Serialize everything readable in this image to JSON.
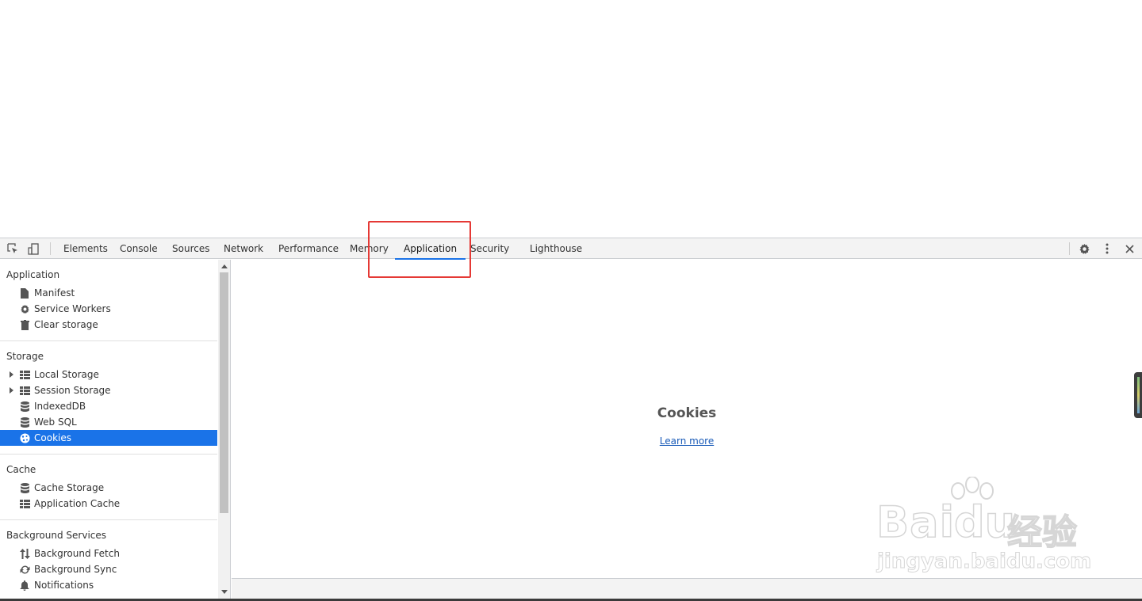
{
  "toolbar": {
    "inspect_icon": "inspect-element-icon",
    "device_icon": "device-toolbar-icon",
    "tabs": [
      {
        "label": "Elements"
      },
      {
        "label": "Console"
      },
      {
        "label": "Sources"
      },
      {
        "label": "Network"
      },
      {
        "label": "Performance"
      },
      {
        "label": "Memory"
      },
      {
        "label": "Application"
      },
      {
        "label": "Security"
      },
      {
        "label": "Lighthouse"
      }
    ],
    "active_tab": "Application",
    "settings_icon": "gear-icon",
    "menu_icon": "kebab-menu-icon",
    "close_icon": "close-icon"
  },
  "sidebar": {
    "application": {
      "title": "Application",
      "items": [
        {
          "label": "Manifest",
          "icon": "file-icon"
        },
        {
          "label": "Service Workers",
          "icon": "gear-icon"
        },
        {
          "label": "Clear storage",
          "icon": "trash-icon"
        }
      ]
    },
    "storage": {
      "title": "Storage",
      "items": [
        {
          "label": "Local Storage",
          "icon": "grid-icon"
        },
        {
          "label": "Session Storage",
          "icon": "grid-icon"
        },
        {
          "label": "IndexedDB",
          "icon": "database-icon"
        },
        {
          "label": "Web SQL",
          "icon": "database-icon"
        },
        {
          "label": "Cookies",
          "icon": "cookie-icon",
          "selected": true
        }
      ]
    },
    "cache": {
      "title": "Cache",
      "items": [
        {
          "label": "Cache Storage",
          "icon": "database-icon"
        },
        {
          "label": "Application Cache",
          "icon": "grid-icon"
        }
      ]
    },
    "background": {
      "title": "Background Services",
      "items": [
        {
          "label": "Background Fetch",
          "icon": "arrows-updown-icon"
        },
        {
          "label": "Background Sync",
          "icon": "sync-icon"
        },
        {
          "label": "Notifications",
          "icon": "bell-icon"
        }
      ]
    }
  },
  "main": {
    "title": "Cookies",
    "link": "Learn more"
  },
  "watermark": {
    "brand": "Bai",
    "brand2": "du",
    "cn": "经验",
    "url": "jingyan.baidu.com"
  },
  "colors": {
    "accent": "#1a73e8",
    "annotation": "#e53935"
  }
}
